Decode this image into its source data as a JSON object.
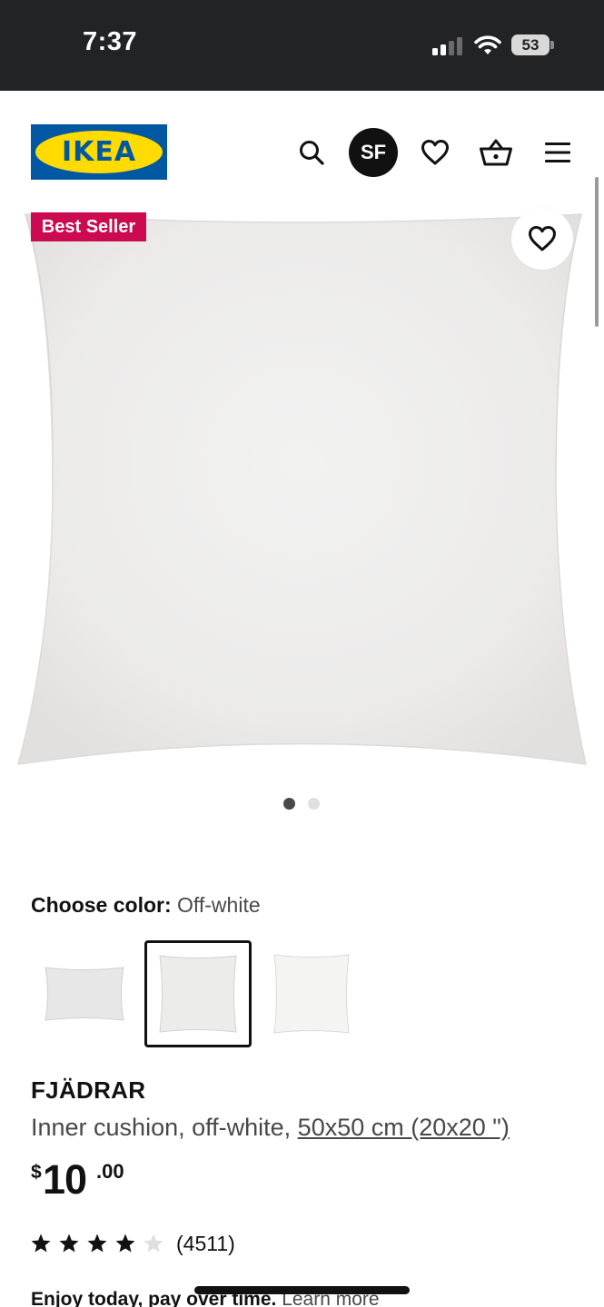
{
  "status_bar": {
    "time": "7:37",
    "battery": "53",
    "signal_icon": "signal-icon",
    "wifi_icon": "wifi-icon"
  },
  "header": {
    "logo_text": "IKEA",
    "avatar_initials": "SF",
    "icons": [
      "search-icon",
      "heart-icon",
      "basket-icon",
      "menu-icon"
    ]
  },
  "product_media": {
    "badge": "Best Seller",
    "image_count": 2,
    "active_image": 1
  },
  "color": {
    "label": "Choose color:",
    "value": "Off-white",
    "selected_index": 1
  },
  "product": {
    "name": "FJÄDRAR",
    "description": "Inner cushion, off-white, ",
    "size_link": "50x50 cm (20x20 \")",
    "price_currency": "$",
    "price_integer": "10",
    "price_decimal": ".00",
    "rating": 4,
    "rating_max": 5,
    "review_count": "(4511)"
  },
  "financing": {
    "text": "Enjoy today, pay over time.",
    "link": "Learn more"
  },
  "colors": {
    "status_bar_bg": "#222325",
    "ikea_blue": "#0058a3",
    "ikea_yellow": "#ffdb00",
    "badge_red": "#cc0a4f"
  }
}
